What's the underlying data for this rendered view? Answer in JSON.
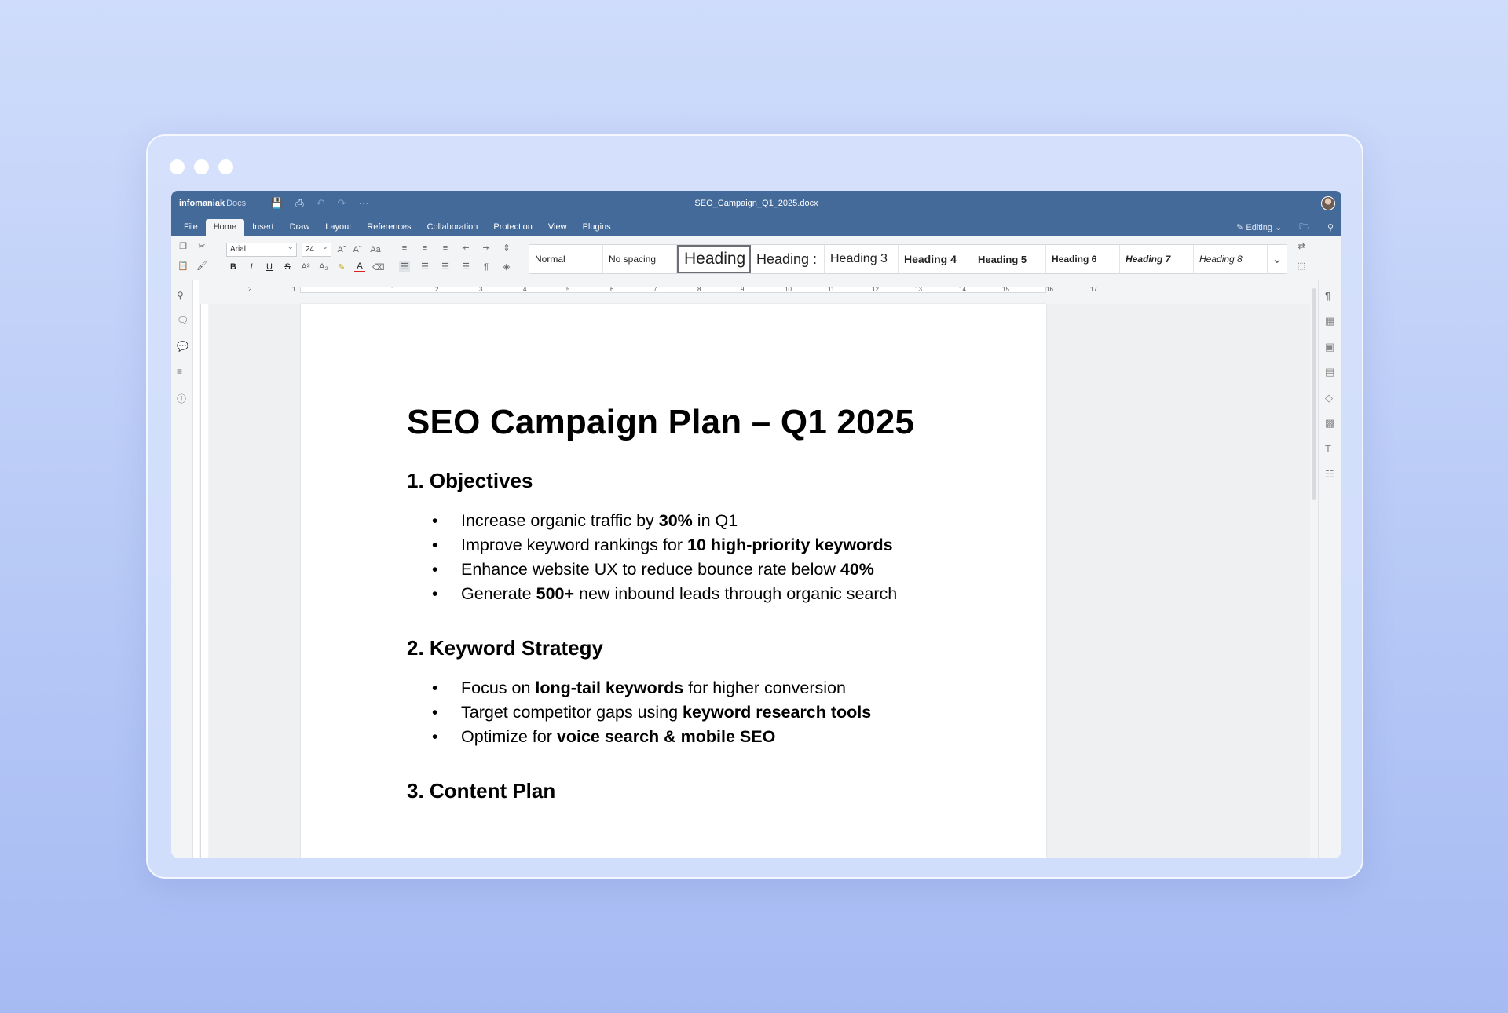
{
  "app": {
    "brand_name": "infomaniak",
    "brand_product": "Docs",
    "document_title": "SEO_Campaign_Q1_2025.docx"
  },
  "menu": {
    "items": [
      "File",
      "Home",
      "Insert",
      "Draw",
      "Layout",
      "References",
      "Collaboration",
      "Protection",
      "View",
      "Plugins"
    ],
    "active": "Home",
    "mode_label": "Editing"
  },
  "toolbar": {
    "font_family": "Arial",
    "font_size": "24",
    "styles": [
      "Normal",
      "No spacing",
      "Heading",
      "Heading :",
      "Heading 3",
      "Heading 4",
      "Heading 5",
      "Heading 6",
      "Heading 7",
      "Heading 8"
    ]
  },
  "ruler": {
    "numbers": [
      "2",
      "1",
      "1",
      "2",
      "3",
      "4",
      "5",
      "6",
      "7",
      "8",
      "9",
      "10",
      "11",
      "12",
      "13",
      "14",
      "15",
      "16",
      "17"
    ]
  },
  "document": {
    "title": "SEO Campaign Plan – Q1 2025",
    "sections": [
      {
        "heading": "1. Objectives",
        "items": [
          [
            {
              "t": "Increase organic traffic by "
            },
            {
              "t": "30%",
              "b": true
            },
            {
              "t": " in Q1"
            }
          ],
          [
            {
              "t": "Improve keyword rankings for "
            },
            {
              "t": "10 high-priority keywords",
              "b": true
            }
          ],
          [
            {
              "t": "Enhance website UX to reduce bounce rate below "
            },
            {
              "t": "40%",
              "b": true
            }
          ],
          [
            {
              "t": "Generate "
            },
            {
              "t": "500+",
              "b": true
            },
            {
              "t": " new inbound leads through organic search"
            }
          ]
        ]
      },
      {
        "heading": "2. Keyword Strategy",
        "items": [
          [
            {
              "t": "Focus on "
            },
            {
              "t": "long-tail keywords",
              "b": true
            },
            {
              "t": " for higher conversion"
            }
          ],
          [
            {
              "t": "Target competitor gaps using "
            },
            {
              "t": "keyword research tools",
              "b": true
            }
          ],
          [
            {
              "t": "Optimize for "
            },
            {
              "t": "voice search & mobile SEO",
              "b": true
            }
          ]
        ]
      },
      {
        "heading": "3. Content Plan",
        "items": []
      }
    ]
  }
}
